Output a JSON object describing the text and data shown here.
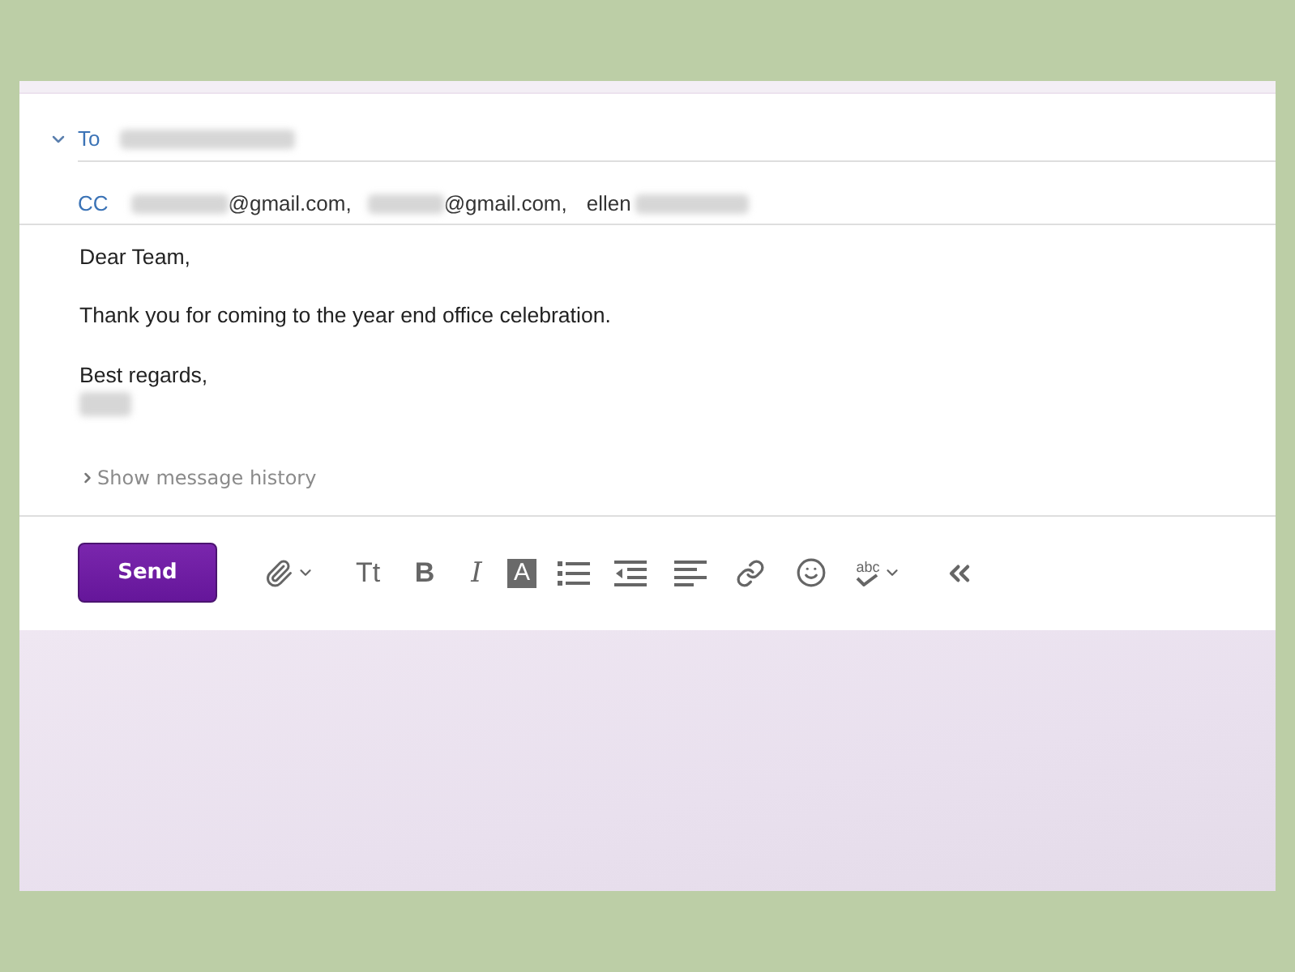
{
  "compose": {
    "to": {
      "label": "To",
      "expanded": true
    },
    "cc": {
      "label": "CC",
      "recipients": [
        {
          "kind": "domain",
          "text": "@gmail.com,"
        },
        {
          "kind": "domain",
          "text": "@gmail.com,"
        },
        {
          "kind": "name",
          "text": "ellen"
        }
      ]
    },
    "body": {
      "greeting": "Dear Team,",
      "message": "Thank you for coming to the year end office celebration.",
      "closing": "Best regards,"
    },
    "history_link": "Show message history",
    "toolbar": {
      "send": "Send",
      "text_size": "Tt",
      "bold": "B",
      "italic": "I",
      "text_color": "A",
      "spellcheck": "abc"
    }
  }
}
